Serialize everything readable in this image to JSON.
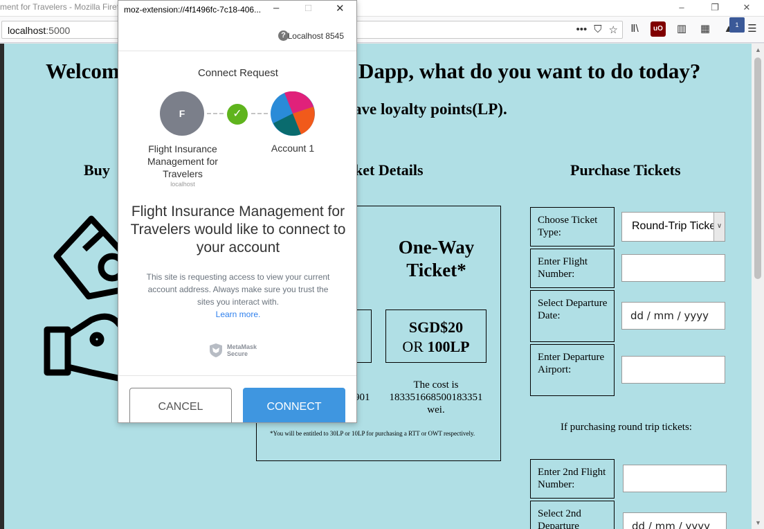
{
  "browser": {
    "window_title": "ment for Travelers - Mozilla Firefox",
    "url_host": "localhost",
    "url_port": ":5000"
  },
  "page": {
    "heading_left": "Welcom",
    "heading_right": "Dapp, what do you want to do today?",
    "subheading": "ave loyalty points(LP).",
    "col_buy_title": "Buy",
    "col_details_title": "ket Details",
    "col_purchase_title": "Purchase Tickets",
    "ticket_title": "One-Way Ticket*",
    "price_line1": "SGD$20",
    "price_line2_prefix": "OR ",
    "price_line2_bold": "100LP",
    "cost_left_partial": "901",
    "cost_label": "The cost is",
    "cost_value": "183351668500183351",
    "cost_unit": "wei.",
    "footnote": "*You will be entitled to 30LP or 10LP for purchasing a RTT or OWT respectively.",
    "form": {
      "ticket_type_label": "Choose Ticket Type:",
      "ticket_type_value": "Round-Trip Ticket",
      "flight_number_label": "Enter Flight Number:",
      "departure_date_label": "Select Departure Date:",
      "departure_date_placeholder": "dd / mm / yyyy",
      "departure_airport_label": "Enter Departure Airport:",
      "round_trip_note": "If purchasing round trip tickets:",
      "flight_number_2_label": "Enter 2nd Flight Number:",
      "departure_date_2_label": "Select 2nd Departure",
      "departure_date_2_placeholder": "dd / mm / yyyy"
    }
  },
  "popup": {
    "title": "moz-extension://4f1496fc-7c18-406...",
    "network": "Localhost 8545",
    "heading": "Connect Request",
    "site_initial": "F",
    "site_name": "Flight Insurance Management for Travelers",
    "site_host": "localhost",
    "account_name": "Account 1",
    "main_message": "Flight Insurance Management for Travelers would like to connect to your account",
    "sub_message": "This site is requesting access to view your current account address. Always make sure you trust the sites you interact with.",
    "learn_more": "Learn more.",
    "secure_line1": "MetaMask",
    "secure_line2": "Secure",
    "cancel_label": "CANCEL",
    "connect_label": "CONNECT"
  },
  "colors": {
    "page_bg": "#b0dfe5",
    "connect_button": "#3f96e0",
    "check_green": "#5fb41d",
    "pie": [
      "#e0217a",
      "#f15a1b",
      "#0a6b6e",
      "#2a8bd8"
    ]
  }
}
